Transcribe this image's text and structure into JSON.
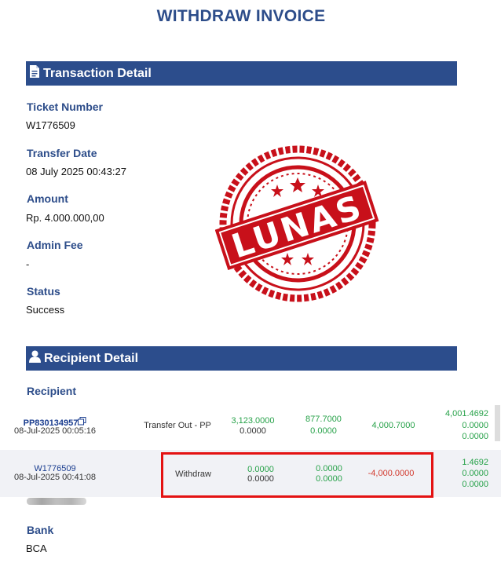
{
  "page": {
    "title": "WITHDRAW INVOICE"
  },
  "transaction": {
    "section_title": "Transaction Detail",
    "ticket_label": "Ticket Number",
    "ticket_value": "W1776509",
    "date_label": "Transfer Date",
    "date_value": "08 July 2025 00:43:27",
    "amount_label": "Amount",
    "amount_value": "Rp. 4.000.000,00",
    "fee_label": "Admin Fee",
    "fee_value": "-",
    "status_label": "Status",
    "status_value": "Success"
  },
  "stamp": {
    "text": "LUNAS",
    "color": "#c8101a"
  },
  "recipient": {
    "section_title": "Recipient Detail",
    "recipient_label": "Recipient",
    "rows": [
      {
        "id": "PP830134957",
        "date": "08-Jul-2025 00:05:16",
        "type": "Transfer Out - PP",
        "col1_top": "3,123.0000",
        "col1_bottom": "0.0000",
        "col2_top": "877.7000",
        "col2_bottom": "0.0000",
        "amount": "4,000.7000",
        "bal_1": "4,001.4692",
        "bal_2": "0.0000",
        "bal_3": "0.0000"
      },
      {
        "id": "W1776509",
        "date": "08-Jul-2025 00:41:08",
        "type": "Withdraw",
        "col1_top": "0.0000",
        "col1_bottom": "0.0000",
        "col2_top": "0.0000",
        "col2_bottom": "0.0000",
        "amount": "-4,000.0000",
        "bal_1": "1.4692",
        "bal_2": "0.0000",
        "bal_3": "0.0000"
      }
    ],
    "bank_label": "Bank",
    "bank_value": "BCA"
  },
  "colors": {
    "header_bar": "#2c4d8c",
    "label": "#2d4d8a",
    "highlight_box": "#e41212"
  }
}
